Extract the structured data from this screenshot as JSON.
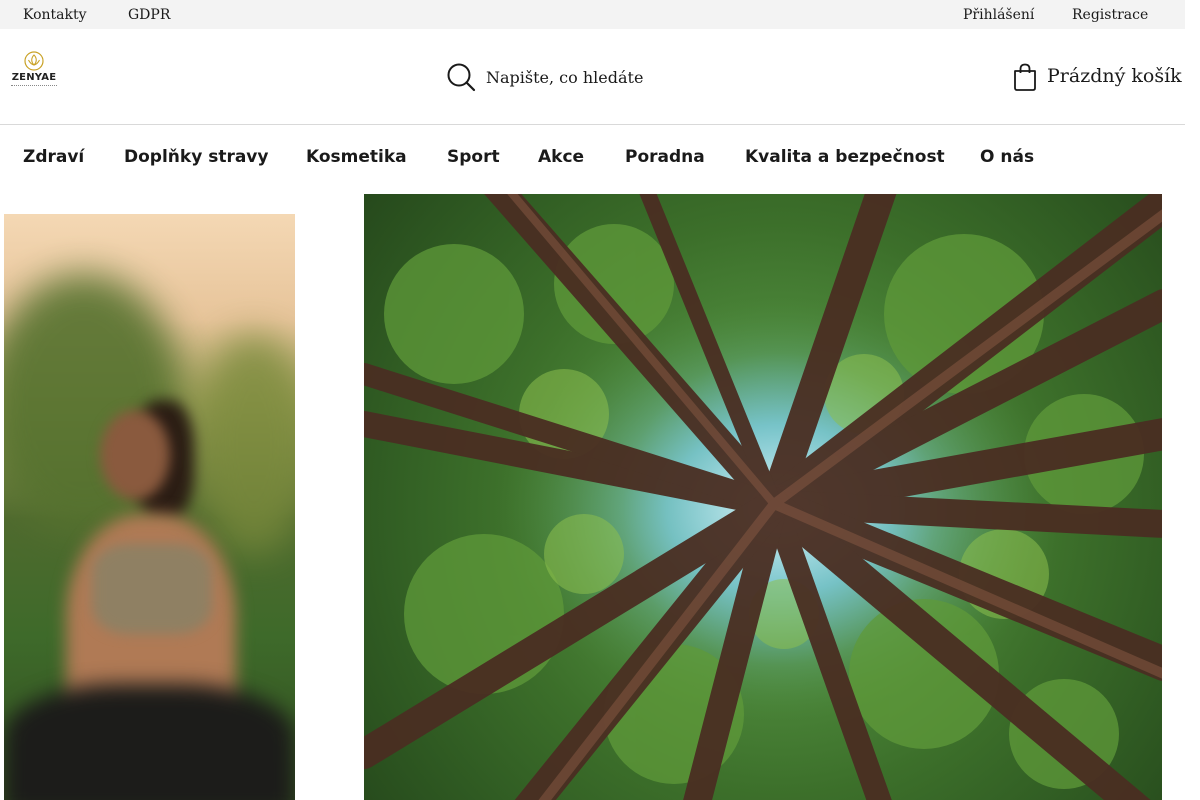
{
  "topbar": {
    "left_links": [
      "Kontakty",
      "GDPR"
    ],
    "right_links": [
      "Přihlášení",
      "Registrace"
    ]
  },
  "header": {
    "logo": {
      "brand": "ZENYAE",
      "icon": "lotus-icon",
      "accent_color": "#c9a227"
    },
    "search": {
      "placeholder": "Napište, co hledáte",
      "value": "",
      "icon": "search-icon"
    },
    "cart": {
      "label": "Prázdný košík",
      "icon": "shopping-bag-icon"
    }
  },
  "nav": {
    "items": [
      "Zdraví",
      "Doplňky stravy",
      "Kosmetika",
      "Sport",
      "Akce",
      "Poradna",
      "Kvalita a bezpečnost",
      "O nás"
    ]
  },
  "images": {
    "left": "blurred-woman-yoga-photo",
    "right": "forest-canopy-from-below-photo"
  }
}
